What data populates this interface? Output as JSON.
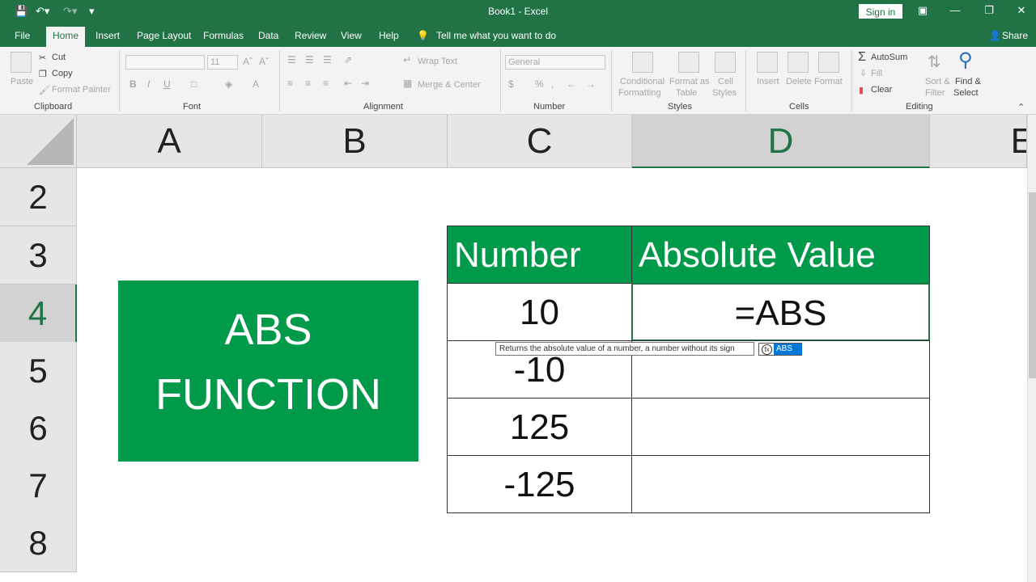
{
  "titlebar": {
    "title": "Book1 - Excel",
    "signin": "Sign in"
  },
  "tabs": [
    "File",
    "Home",
    "Insert",
    "Page Layout",
    "Formulas",
    "Data",
    "Review",
    "View",
    "Help"
  ],
  "tellme": "Tell me what you want to do",
  "share": "Share",
  "ribbon": {
    "clipboard": {
      "paste": "Paste",
      "cut": "Cut",
      "copy": "Copy",
      "format_painter": "Format Painter",
      "label": "Clipboard"
    },
    "font": {
      "size": "11",
      "label": "Font"
    },
    "alignment": {
      "wrap_text": "Wrap Text",
      "merge_center": "Merge & Center",
      "label": "Alignment"
    },
    "number": {
      "format": "General",
      "label": "Number"
    },
    "styles": {
      "conditional": "Conditional",
      "formatting": "Formatting",
      "format_as": "Format as",
      "table": "Table",
      "cell": "Cell",
      "cell_styles": "Styles",
      "label": "Styles"
    },
    "cells": {
      "insert": "Insert",
      "delete": "Delete",
      "format": "Format",
      "label": "Cells"
    },
    "editing": {
      "autosum": "AutoSum",
      "fill": "Fill",
      "clear": "Clear",
      "sort": "Sort &",
      "filter": "Filter",
      "find": "Find &",
      "select": "Select",
      "label": "Editing"
    }
  },
  "columns": [
    "A",
    "B",
    "C",
    "D",
    "E"
  ],
  "rows": [
    "2",
    "3",
    "4",
    "5",
    "6",
    "7",
    "8"
  ],
  "banner": {
    "line1": "ABS",
    "line2": "FUNCTION"
  },
  "table": {
    "headers": [
      "Number",
      "Absolute Value"
    ],
    "numbers": [
      "10",
      "-10",
      "125",
      "-125"
    ],
    "editing_cell": "=ABS"
  },
  "tooltip": "Returns the absolute value of a number, a number without its sign",
  "autocomplete": "ABS",
  "colors": {
    "excel_green": "#217346",
    "banner_green": "#009a4a"
  }
}
